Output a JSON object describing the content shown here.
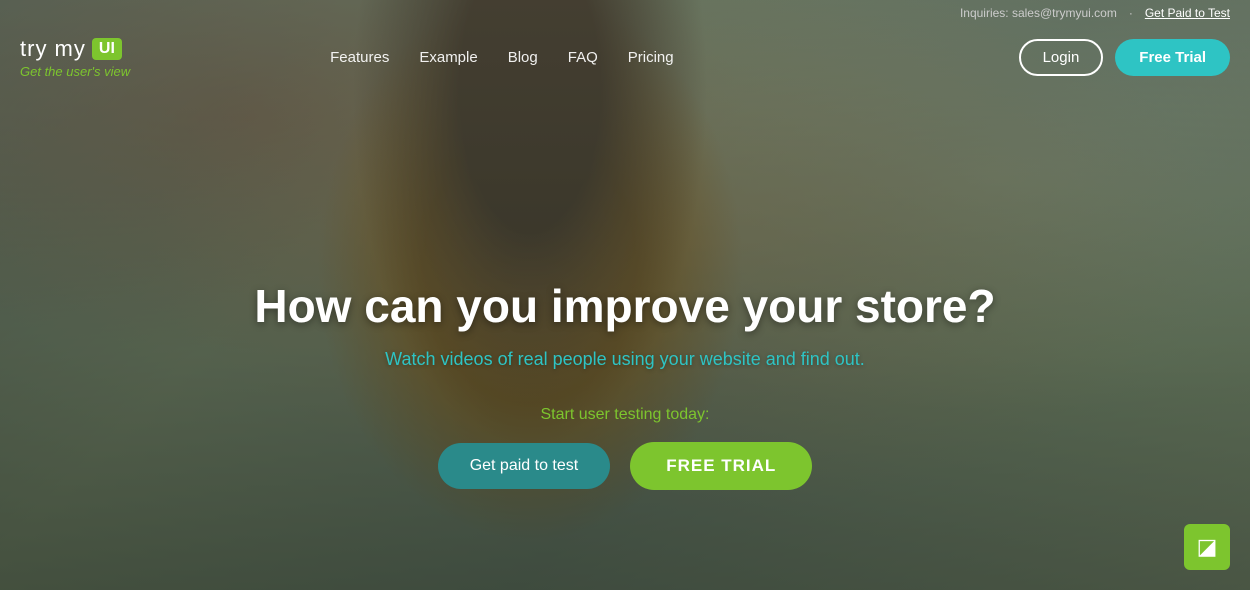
{
  "top_info": {
    "inquiries_label": "Inquiries: sales@trymyui.com",
    "divider": "·",
    "get_paid_link": "Get Paid to Test"
  },
  "logo": {
    "try_my": "try my",
    "ui_badge": "UI",
    "tagline": "Get the user's view"
  },
  "nav": {
    "links": [
      {
        "label": "Features",
        "id": "features"
      },
      {
        "label": "Example",
        "id": "example"
      },
      {
        "label": "Blog",
        "id": "blog"
      },
      {
        "label": "FAQ",
        "id": "faq"
      },
      {
        "label": "Pricing",
        "id": "pricing"
      }
    ],
    "login_label": "Login",
    "free_trial_label": "Free Trial"
  },
  "hero": {
    "headline": "How can you improve your store?",
    "subheadline_pre": "Watch ",
    "subheadline_highlight": "videos",
    "subheadline_post": " of real people using your website and find out.",
    "cta_label": "Start user testing today:",
    "btn_get_paid": "Get paid to test",
    "btn_free_trial": "FREE TRIAL"
  },
  "chat": {
    "icon": "💬"
  }
}
